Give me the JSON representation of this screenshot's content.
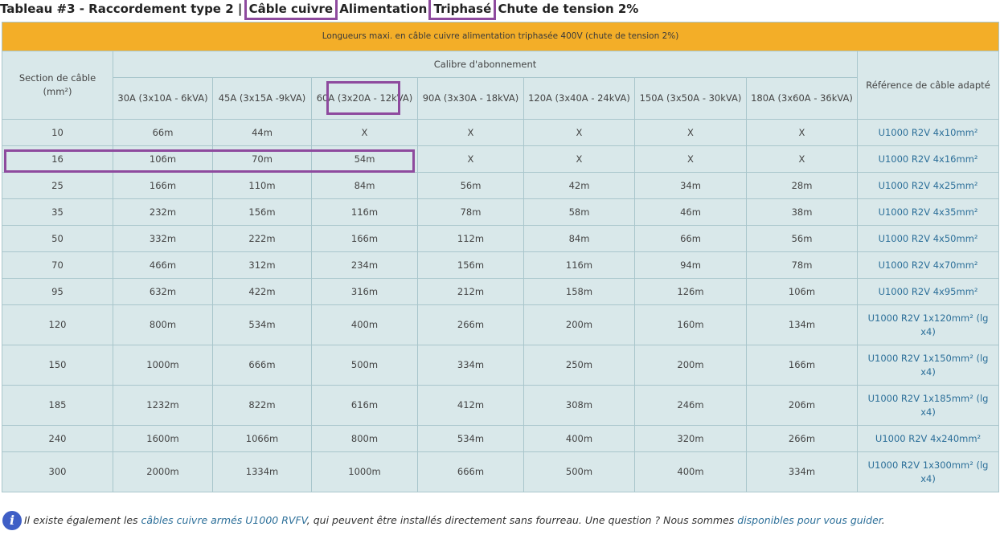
{
  "title": {
    "prefix": "Tableau #3 - Raccordement type 2 |",
    "cable": "Câble cuivre",
    "alim": "Alimentation",
    "phase": "Triphasé",
    "chute": "Chute de tension 2%"
  },
  "table": {
    "banner": "Longueurs maxi. en câble cuivre alimentation triphasée 400V (chute de tension 2%)",
    "section_header": "Section de câble (mm²)",
    "calibre_header": "Calibre d'abonnement",
    "ref_header": "Référence de câble adapté",
    "calibres": [
      "30A (3x10A - 6kVA)",
      "45A (3x15A -9kVA)",
      "60A (3x20A - 12kVA)",
      "90A (3x30A - 18kVA)",
      "120A (3x40A - 24kVA)",
      "150A (3x50A - 30kVA)",
      "180A (3x60A - 36kVA)"
    ],
    "rows": [
      {
        "section": "10",
        "vals": [
          "66m",
          "44m",
          "X",
          "X",
          "X",
          "X",
          "X"
        ],
        "ref": "U1000 R2V 4x10mm²"
      },
      {
        "section": "16",
        "vals": [
          "106m",
          "70m",
          "54m",
          "X",
          "X",
          "X",
          "X"
        ],
        "ref": "U1000 R2V 4x16mm²"
      },
      {
        "section": "25",
        "vals": [
          "166m",
          "110m",
          "84m",
          "56m",
          "42m",
          "34m",
          "28m"
        ],
        "ref": "U1000 R2V 4x25mm²"
      },
      {
        "section": "35",
        "vals": [
          "232m",
          "156m",
          "116m",
          "78m",
          "58m",
          "46m",
          "38m"
        ],
        "ref": "U1000 R2V 4x35mm²"
      },
      {
        "section": "50",
        "vals": [
          "332m",
          "222m",
          "166m",
          "112m",
          "84m",
          "66m",
          "56m"
        ],
        "ref": "U1000 R2V 4x50mm²"
      },
      {
        "section": "70",
        "vals": [
          "466m",
          "312m",
          "234m",
          "156m",
          "116m",
          "94m",
          "78m"
        ],
        "ref": "U1000 R2V 4x70mm²"
      },
      {
        "section": "95",
        "vals": [
          "632m",
          "422m",
          "316m",
          "212m",
          "158m",
          "126m",
          "106m"
        ],
        "ref": "U1000 R2V 4x95mm²"
      },
      {
        "section": "120",
        "vals": [
          "800m",
          "534m",
          "400m",
          "266m",
          "200m",
          "160m",
          "134m"
        ],
        "ref": "U1000 R2V 1x120mm² (lg x4)"
      },
      {
        "section": "150",
        "vals": [
          "1000m",
          "666m",
          "500m",
          "334m",
          "250m",
          "200m",
          "166m"
        ],
        "ref": "U1000 R2V 1x150mm² (lg x4)"
      },
      {
        "section": "185",
        "vals": [
          "1232m",
          "822m",
          "616m",
          "412m",
          "308m",
          "246m",
          "206m"
        ],
        "ref": "U1000 R2V 1x185mm² (lg x4)"
      },
      {
        "section": "240",
        "vals": [
          "1600m",
          "1066m",
          "800m",
          "534m",
          "400m",
          "320m",
          "266m"
        ],
        "ref": "U1000 R2V 4x240mm²"
      },
      {
        "section": "300",
        "vals": [
          "2000m",
          "1334m",
          "1000m",
          "666m",
          "500m",
          "400m",
          "334m"
        ],
        "ref": "U1000 R2V 1x300mm² (lg x4)"
      }
    ]
  },
  "footer": {
    "icon": "info-icon",
    "text1": "Il existe également les ",
    "link1": "câbles cuivre armés U1000 RVFV",
    "text2": ", qui peuvent être installés directement sans fourreau. Une question ? Nous sommes ",
    "link2": "disponibles pour vous guider",
    "text3": "."
  },
  "colors": {
    "banner": "#f3ae28",
    "cell": "#d9e8ea",
    "highlight": "#8e4a9e",
    "link": "#2c6f99"
  }
}
